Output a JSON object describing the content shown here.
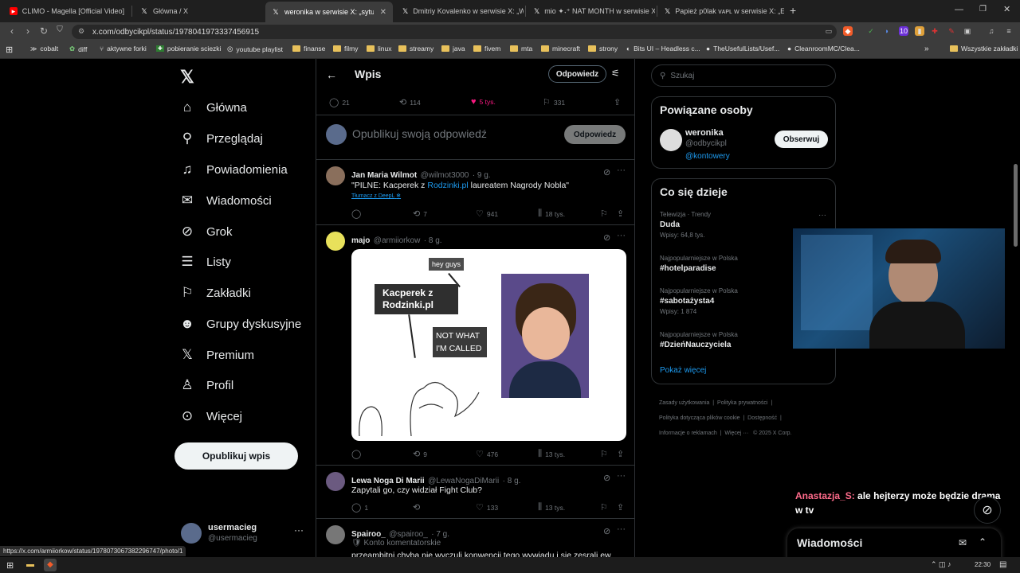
{
  "tabs": [
    {
      "title": "CLIMO - Magella [Official Video]",
      "favicon": "youtube-icon"
    },
    {
      "title": "Główna / X",
      "favicon": "x-icon"
    },
    {
      "title": "weronika w serwisie X: „sytuacja",
      "favicon": "x-icon"
    },
    {
      "title": "Dmitriy Kovalenko w serwisie X: „Wh",
      "favicon": "x-icon"
    },
    {
      "title": "mio ✦˖⁺ NAT MONTH w serwisie X:",
      "favicon": "x-icon"
    },
    {
      "title": "Papież p0lak ᴠᴀᴘʟ w serwisie X: „Eleg",
      "favicon": "x-icon"
    }
  ],
  "address": {
    "url": "x.com/odbycikpl/status/1978041973337456915"
  },
  "bookmarks": [
    {
      "label": "cobalt"
    },
    {
      "label": "diff"
    },
    {
      "label": "aktywne forki"
    },
    {
      "label": "pobieranie sciezki"
    },
    {
      "label": "youtube playlist"
    },
    {
      "label": "finanse"
    },
    {
      "label": "filmy"
    },
    {
      "label": "linux"
    },
    {
      "label": "streamy"
    },
    {
      "label": "java"
    },
    {
      "label": "fivem"
    },
    {
      "label": "mta"
    },
    {
      "label": "minecraft"
    },
    {
      "label": "strony"
    },
    {
      "label": "Bits UI – Headless c..."
    },
    {
      "label": "TheUsefulLists/Usef..."
    },
    {
      "label": "CleanroomMC/Clea..."
    },
    {
      "label": "Wszystkie zakładki"
    }
  ],
  "sidebar": {
    "items": [
      {
        "label": "Główna",
        "icon": "home-icon"
      },
      {
        "label": "Przeglądaj",
        "icon": "search-icon"
      },
      {
        "label": "Powiadomienia",
        "icon": "bell-icon"
      },
      {
        "label": "Wiadomości",
        "icon": "mail-icon"
      },
      {
        "label": "Grok",
        "icon": "grok-icon"
      },
      {
        "label": "Listy",
        "icon": "list-icon"
      },
      {
        "label": "Zakładki",
        "icon": "bookmark-icon"
      },
      {
        "label": "Grupy dyskusyjne",
        "icon": "people-icon"
      },
      {
        "label": "Premium",
        "icon": "x-icon"
      },
      {
        "label": "Profil",
        "icon": "person-icon"
      },
      {
        "label": "Więcej",
        "icon": "more-circle-icon"
      }
    ],
    "post_button": "Opublikuj wpis",
    "user": {
      "name": "usermacieg",
      "handle": "@usermacieg"
    }
  },
  "header": {
    "title": "Wpis",
    "reply_button": "Odpowiedz"
  },
  "main_post_actions": {
    "replies": "21",
    "reposts": "114",
    "likes": "5 tys.",
    "bookmarks": "331"
  },
  "composer": {
    "placeholder": "Opublikuj swoją odpowiedź",
    "button": "Odpowiedz"
  },
  "replies": [
    {
      "name": "Jan Maria Wilmot",
      "handle": "@wilmot3000",
      "time": "· 9 g.",
      "text_pre": "\"PILNE: Kacperek z ",
      "text_link": "Rodzinki.pl",
      "text_post": " laureatem Nagrody Nobla\"",
      "translate": "Tłumacz z DeepL",
      "replies": "",
      "reposts": "7",
      "likes": "941",
      "views": "18 tys."
    },
    {
      "name": "majo",
      "handle": "@armiiorkow",
      "time": "· 8 g.",
      "image": {
        "bubble1": "hey guys",
        "box": "Kacperek z Rodzinki.pl",
        "bubble2": "NOT WHAT I'M CALLED"
      },
      "replies": "",
      "reposts": "9",
      "likes": "476",
      "views": "13 tys."
    },
    {
      "name": "Lewa Noga Di Marii",
      "handle": "@LewaNogaDiMarii",
      "time": "· 8 g.",
      "text": "Zapytali go, czy widział Fight Club?",
      "replies": "1",
      "reposts": "",
      "likes": "133",
      "views": "13 tys."
    },
    {
      "name": "Spairoo_",
      "handle": "@spairoo_",
      "time": "· 7 g.",
      "text": "🛡 Konto komentatorskie",
      "text2": "przeambitni chyba nie wyczuli konwencji tego wywiadu i się zesrali ew"
    }
  ],
  "search": {
    "placeholder": "Szukaj"
  },
  "related": {
    "title": "Powiązane osoby",
    "name": "weronika",
    "handle": "@odbycikpl",
    "bio_link": "@kontowery",
    "follow": "Obserwuj"
  },
  "trends": {
    "title": "Co się dzieje",
    "items": [
      {
        "category": "Telewizja · Trendy",
        "name": "Duda",
        "count": "Wpisy: 64,8 tys."
      },
      {
        "category": "Najpopularniejsze w Polska",
        "name": "#hotelparadise",
        "count": ""
      },
      {
        "category": "Najpopularniejsze w Polska",
        "name": "#sabotażysta4",
        "count": "Wpisy: 1 874"
      },
      {
        "category": "Najpopularniejsze w Polska",
        "name": "#DzieńNauczyciela",
        "count": ""
      }
    ],
    "more": "Pokaż więcej"
  },
  "footer": {
    "links": [
      "Zasady użytkowania",
      "Polityka prywatności",
      "Polityka dotycząca plików cookie",
      "Dostępność",
      "Informacje o reklamach",
      "Więcej ···",
      "© 2025 X Corp."
    ]
  },
  "chat": {
    "user": "Anastazja_S:",
    "message": "ale hejterzy może będzie drama w tv"
  },
  "messages_dock": {
    "title": "Wiadomości"
  },
  "status_url": "https://x.com/armiiorkow/status/1978073067382296747/photo/1",
  "taskbar": {
    "time": "22:30"
  },
  "colors": {
    "like": "#f91880",
    "link": "#1d9bf0",
    "chat_user": "#ff6b8b"
  }
}
